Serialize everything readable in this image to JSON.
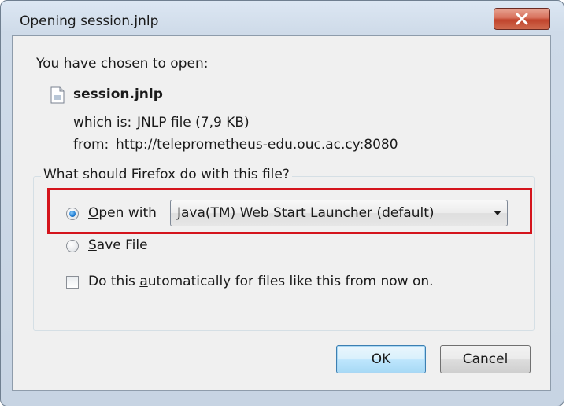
{
  "window": {
    "title": "Opening session.jnlp",
    "close_glyph": "✕"
  },
  "intro": "You have chosen to open:",
  "file": {
    "icon": "document-icon",
    "name": "session.jnlp",
    "which_is_label": "which is:",
    "type": "JNLP file (7,9 KB)",
    "from_label": "from:",
    "source": "http://teleprometheus-edu.ouc.ac.cy:8080"
  },
  "action": {
    "group_label": "What should Firefox do with this file?",
    "open_with": {
      "prefix": "",
      "accel": "O",
      "suffix": "pen with",
      "selected": true
    },
    "application": "Java(TM) Web Start Launcher (default)",
    "save_file": {
      "accel": "S",
      "suffix": "ave File",
      "selected": false
    },
    "auto": {
      "prefix": "Do this ",
      "accel": "a",
      "suffix": "utomatically for files like this from now on.",
      "checked": false
    }
  },
  "buttons": {
    "ok": "OK",
    "cancel": "Cancel"
  },
  "colors": {
    "highlight": "#d4141c",
    "close_button": "#c0432c",
    "default_button": "#3c7fb1"
  }
}
